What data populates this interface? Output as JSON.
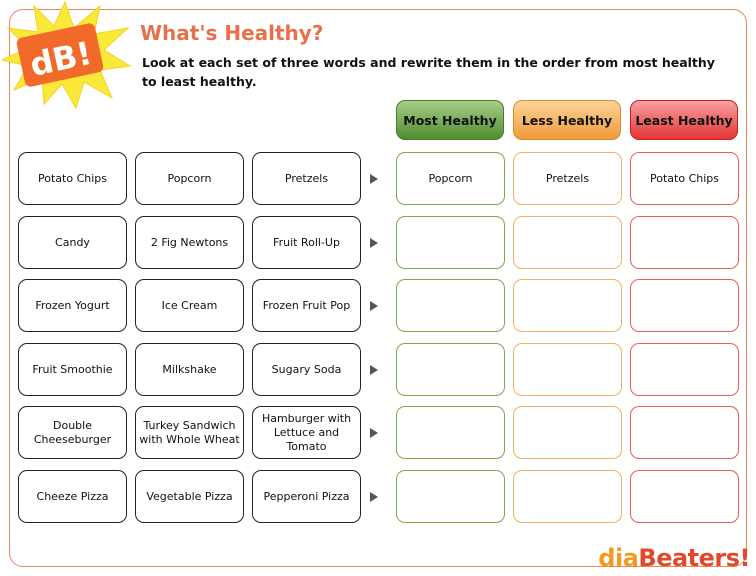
{
  "logo_badge": "dB!",
  "title": "What's Healthy?",
  "instructions": "Look at each set of three words and rewrite them in the order from most healthy to least healthy.",
  "headers": [
    "Most Healthy",
    "Less Healthy",
    "Least Healthy"
  ],
  "rows": [
    {
      "words": [
        "Potato Chips",
        "Popcorn",
        "Pretzels"
      ],
      "answers": [
        "Popcorn",
        "Pretzels",
        "Potato Chips"
      ]
    },
    {
      "words": [
        "Candy",
        "2 Fig Newtons",
        "Fruit Roll-Up"
      ],
      "answers": [
        "",
        "",
        ""
      ]
    },
    {
      "words": [
        "Frozen Yogurt",
        "Ice Cream",
        "Frozen Fruit Pop"
      ],
      "answers": [
        "",
        "",
        ""
      ]
    },
    {
      "words": [
        "Fruit Smoothie",
        "Milkshake",
        "Sugary Soda"
      ],
      "answers": [
        "",
        "",
        ""
      ]
    },
    {
      "words": [
        "Double Cheeseburger",
        "Turkey Sandwich with Whole Wheat",
        "Hamburger with Lettuce and Tomato"
      ],
      "answers": [
        "",
        "",
        ""
      ]
    },
    {
      "words": [
        "Cheeze Pizza",
        "Vegetable Pizza",
        "Pepperoni Pizza"
      ],
      "answers": [
        "",
        "",
        ""
      ]
    }
  ],
  "footer_logo": {
    "part1": "dia",
    "part2": "Beaters!"
  },
  "colors": {
    "title": "#e8704a",
    "green": "#5a9a38",
    "orange": "#f09a3a",
    "red": "#e23535",
    "frame": "#e8875a"
  }
}
